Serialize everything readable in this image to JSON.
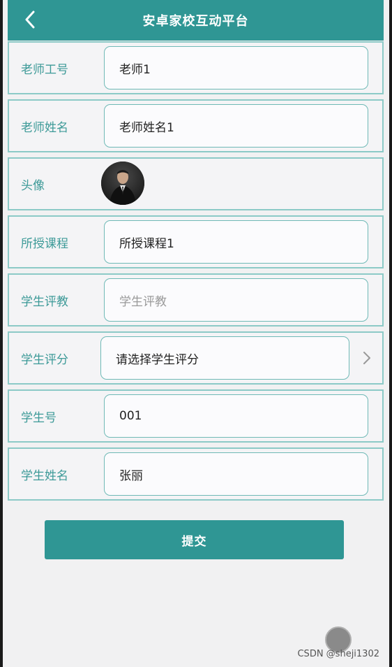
{
  "header": {
    "title": "安卓家校互动平台",
    "back_icon": "chevron-left-icon"
  },
  "form": {
    "fields": [
      {
        "label": "老师工号",
        "value": "老师1"
      },
      {
        "label": "老师姓名",
        "value": "老师姓名1"
      },
      {
        "label": "头像",
        "avatar_icon": "teacher-avatar"
      },
      {
        "label": "所授课程",
        "value": "所授课程1"
      },
      {
        "label": "学生评教",
        "placeholder": "学生评教"
      },
      {
        "label": "学生评分",
        "value": "请选择学生评分",
        "chevron_icon": "chevron-right-icon"
      },
      {
        "label": "学生号",
        "value": "001"
      },
      {
        "label": "学生姓名",
        "value": "张丽"
      }
    ]
  },
  "submit_label": "提交",
  "watermark": "CSDN @sheji1302",
  "colors": {
    "primary": "#2f9694",
    "label": "#3d9a98",
    "border": "#8ccac7"
  }
}
